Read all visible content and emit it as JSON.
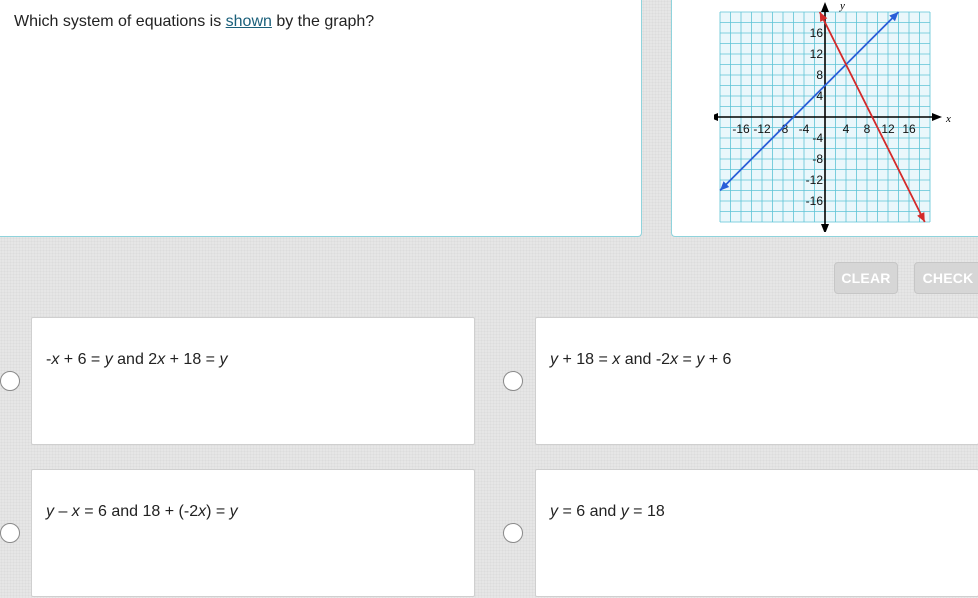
{
  "question": {
    "prefix": "Which system of equations is ",
    "link": "shown",
    "suffix": " by the graph?"
  },
  "graph": {
    "x_axis_label": "x",
    "y_axis_label": "y",
    "x_ticks": [
      "-16",
      "-12",
      "-8",
      "-4",
      "4",
      "8",
      "12",
      "16"
    ],
    "y_ticks": [
      "16",
      "12",
      "8",
      "4",
      "-4",
      "-8",
      "-12",
      "-16"
    ],
    "range": [
      -20,
      20
    ],
    "lines": [
      {
        "color": "#2a5ed8",
        "slope": 1,
        "intercept": 6
      },
      {
        "color": "#d42a2a",
        "slope": -2,
        "intercept": 18
      }
    ]
  },
  "buttons": {
    "clear": "CLEAR",
    "check": "CHECK"
  },
  "choices": [
    {
      "id": "a",
      "parts": [
        "-",
        "x",
        " + 6 = ",
        "y",
        " and 2",
        "x",
        " + 18 = ",
        "y"
      ]
    },
    {
      "id": "b",
      "parts": [
        "",
        "y",
        " + 18 = ",
        "x",
        " and -2",
        "x",
        " = ",
        "y",
        " + 6"
      ]
    },
    {
      "id": "c",
      "parts": [
        "",
        "y",
        " – ",
        "x",
        " = 6 and 18 + (-2",
        "x",
        ") = ",
        "y"
      ]
    },
    {
      "id": "d",
      "parts": [
        "",
        "y",
        " = 6 and ",
        "y",
        " = 18"
      ]
    }
  ]
}
